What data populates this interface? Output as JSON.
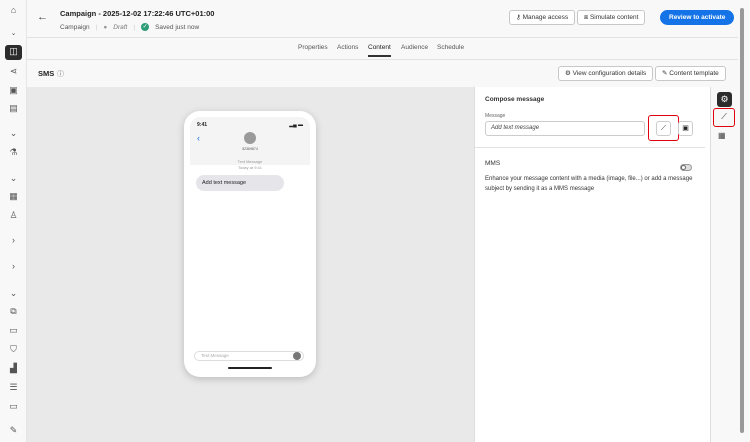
{
  "header": {
    "title": "Campaign - 2025-12-02 17:22:46 UTC+01:00",
    "type": "Campaign",
    "status": "Draft",
    "saved": "Saved just now",
    "manage_access": "Manage access",
    "simulate": "Simulate content",
    "review": "Review to activate"
  },
  "tabs": [
    "Properties",
    "Actions",
    "Content",
    "Audience",
    "Schedule"
  ],
  "channel": {
    "title": "SMS",
    "view_config": "View configuration details",
    "content_template": "Content template"
  },
  "phone": {
    "time": "9:41",
    "contact": "52369874",
    "meta1": "Text Message",
    "meta2": "Today at 9:41",
    "bubble": "Add text message",
    "input_placeholder": "Text Message"
  },
  "compose": {
    "title": "Compose message",
    "message_label": "Message",
    "message_placeholder": "Add text message",
    "mms_title": "MMS",
    "mms_desc": "Enhance your message content with a media (image, file...) or add a message subject by sending it as a MMS message",
    "mms_enabled": false
  },
  "colors": {
    "accent": "#1473e6",
    "highlight": "#e0000f"
  }
}
